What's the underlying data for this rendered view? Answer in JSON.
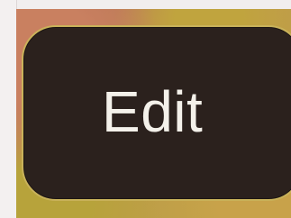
{
  "button": {
    "label": "Edit"
  },
  "colors": {
    "button_background": "#2b211d",
    "button_border": "#c9b25a",
    "label_text": "#f4f1ea",
    "backdrop_warm": "#c19a4c",
    "backdrop_rose": "#b55f5e"
  }
}
